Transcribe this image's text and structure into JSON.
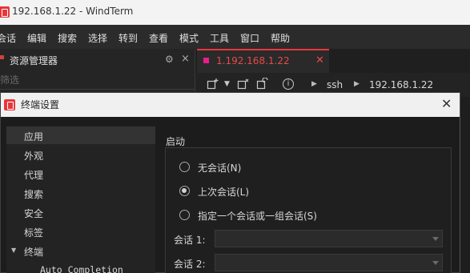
{
  "window": {
    "title": "192.168.1.22 - WindTerm"
  },
  "menu": {
    "items": [
      "会话",
      "编辑",
      "搜索",
      "选择",
      "转到",
      "查看",
      "模式",
      "工具",
      "窗口",
      "帮助"
    ]
  },
  "explorer": {
    "title": "资源管理器",
    "filter_placeholder": "筛选",
    "gear_icon": "gear-icon",
    "close_glyph": "×"
  },
  "session_tab": {
    "label": "1.192.168.1.22",
    "close_glyph": "✕",
    "accent_color": "#e8363b"
  },
  "toolbar": {
    "protocol": "ssh",
    "host": "192.168.1.22"
  },
  "dialog": {
    "title": "终端设置",
    "close_glyph": "✕",
    "nav": {
      "items": [
        {
          "label": "应用",
          "selected": true
        },
        {
          "label": "外观"
        },
        {
          "label": "代理"
        },
        {
          "label": "搜索"
        },
        {
          "label": "安全"
        },
        {
          "label": "标签"
        },
        {
          "label": "终端",
          "expanded": true
        },
        {
          "label": "Auto Completion",
          "child": true
        }
      ]
    },
    "startup": {
      "section_label": "启动",
      "options": [
        {
          "label": "无会话(N)",
          "checked": false
        },
        {
          "label": "上次会话(L)",
          "checked": true
        },
        {
          "label": "指定一个会话或一组会话(S)",
          "checked": false
        }
      ],
      "session_fields": [
        {
          "label": "会话 1:",
          "value": ""
        },
        {
          "label": "会话 2:",
          "value": ""
        }
      ]
    }
  }
}
